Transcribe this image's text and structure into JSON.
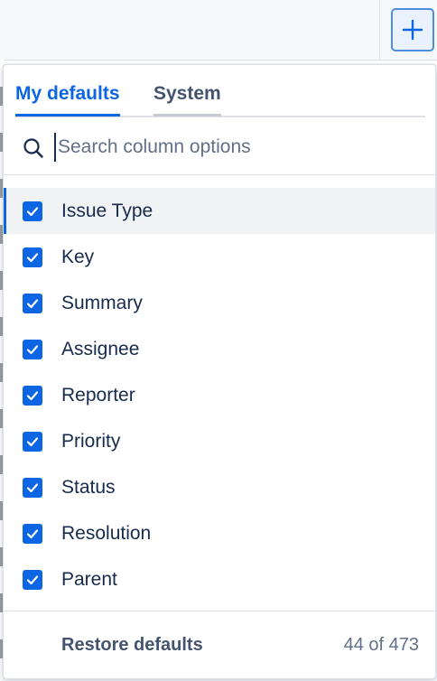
{
  "header": {
    "add_button_icon": "plus-icon"
  },
  "tabs": [
    {
      "label": "My defaults",
      "active": true
    },
    {
      "label": "System",
      "active": false
    }
  ],
  "search": {
    "placeholder": "Search column options",
    "value": "",
    "icon": "search-icon"
  },
  "columns": [
    {
      "label": "Issue Type",
      "checked": true
    },
    {
      "label": "Key",
      "checked": true
    },
    {
      "label": "Summary",
      "checked": true
    },
    {
      "label": "Assignee",
      "checked": true
    },
    {
      "label": "Reporter",
      "checked": true
    },
    {
      "label": "Priority",
      "checked": true
    },
    {
      "label": "Status",
      "checked": true
    },
    {
      "label": "Resolution",
      "checked": true
    },
    {
      "label": "Parent",
      "checked": true
    }
  ],
  "footer": {
    "restore_label": "Restore defaults",
    "count_text": "44 of 473"
  },
  "colors": {
    "accent": "#0c66e4",
    "text": "#172b4d",
    "muted": "#626f86"
  }
}
